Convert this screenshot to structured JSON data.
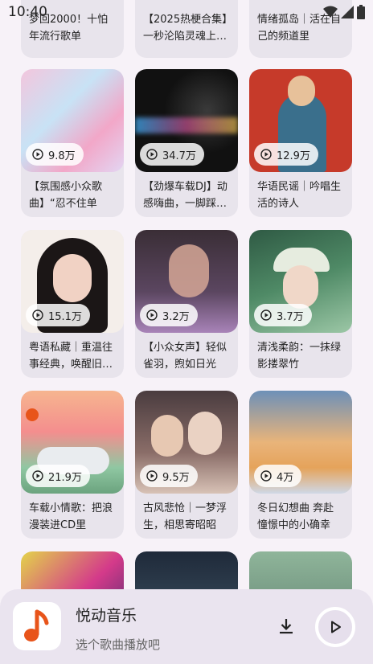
{
  "status": {
    "time": "10:40"
  },
  "cards": [
    {
      "title": "梦回2000！十怕年流行歌单",
      "plays": ""
    },
    {
      "title": "【2025热梗合集】一秒沦陷灵魂上…",
      "plays": ""
    },
    {
      "title": "情绪孤岛｜活在自己的频道里",
      "plays": ""
    },
    {
      "title": "【氛围感小众歌曲】“忍不住单曲…",
      "plays": "9.8万"
    },
    {
      "title": "【劲爆车载DJ】动感嗨曲，一脚踩…",
      "plays": "34.7万"
    },
    {
      "title": "华语民谣｜吟唱生活的诗人",
      "plays": "12.9万"
    },
    {
      "title": "粤语私藏｜重温往事经典，唤醒旧…",
      "plays": "15.1万"
    },
    {
      "title": "【小众女声】轻似雀羽，煦如日光",
      "plays": "3.2万"
    },
    {
      "title": "清浅柔韵：一抹绿影搂翠竹",
      "plays": "3.7万"
    },
    {
      "title": "车载小情歌：把浪漫装进CD里",
      "plays": "21.9万"
    },
    {
      "title": "古风悲怆｜一梦浮生，相思寄昭昭",
      "plays": "9.5万"
    },
    {
      "title": "冬日幻想曲 奔赴憧憬中的小确幸",
      "plays": "4万"
    },
    {
      "title": "",
      "plays": ""
    },
    {
      "title": "",
      "plays": ""
    },
    {
      "title": "",
      "plays": ""
    }
  ],
  "player": {
    "app_name": "悦动音乐",
    "subtitle": "选个歌曲播放吧"
  },
  "colors": {
    "accent": "#e8541a",
    "card_bg": "#e8e4ec"
  }
}
